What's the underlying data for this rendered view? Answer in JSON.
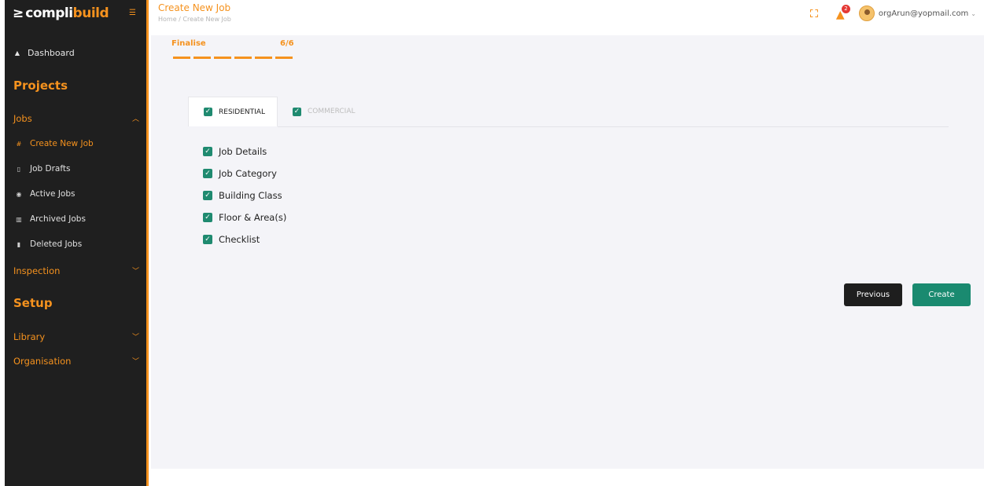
{
  "brand": {
    "mark": "≥",
    "part1": "compli",
    "part2": "build"
  },
  "header": {
    "title": "Create New Job",
    "breadcrumb": "Home / Create New Job",
    "user_email": "orgArun@yopmail.com",
    "notification_count": "2"
  },
  "sidebar": {
    "dashboard": "Dashboard",
    "projects_section": "Projects",
    "jobs_group": "Jobs",
    "jobs_items": [
      {
        "label": "Create New Job",
        "icon": "hash-icon",
        "active": true
      },
      {
        "label": "Job Drafts",
        "icon": "drafts-icon"
      },
      {
        "label": "Active Jobs",
        "icon": "active-icon"
      },
      {
        "label": "Archived Jobs",
        "icon": "archive-icon"
      },
      {
        "label": "Deleted Jobs",
        "icon": "trash-icon"
      }
    ],
    "inspection_group": "Inspection",
    "setup_section": "Setup",
    "library_group": "Library",
    "organisation_group": "Organisation"
  },
  "wizard": {
    "step_label": "Finalise",
    "step_count": "6/6",
    "steps_total": 6,
    "steps_completed": 6
  },
  "tabs": [
    {
      "label": "RESIDENTIAL",
      "active": true,
      "checked": true
    },
    {
      "label": "COMMERCIAL",
      "active": false,
      "checked": true
    }
  ],
  "checklist": [
    {
      "label": "Job Details",
      "checked": true
    },
    {
      "label": "Job Category",
      "checked": true
    },
    {
      "label": "Building Class",
      "checked": true
    },
    {
      "label": "Floor & Area(s)",
      "checked": true
    },
    {
      "label": "Checklist",
      "checked": true
    }
  ],
  "buttons": {
    "previous": "Previous",
    "create": "Create"
  },
  "colors": {
    "accent": "#f5921e",
    "sidebar_bg": "#1f1f1f",
    "success": "#1a8a70",
    "dark_button": "#1e1e1e"
  }
}
